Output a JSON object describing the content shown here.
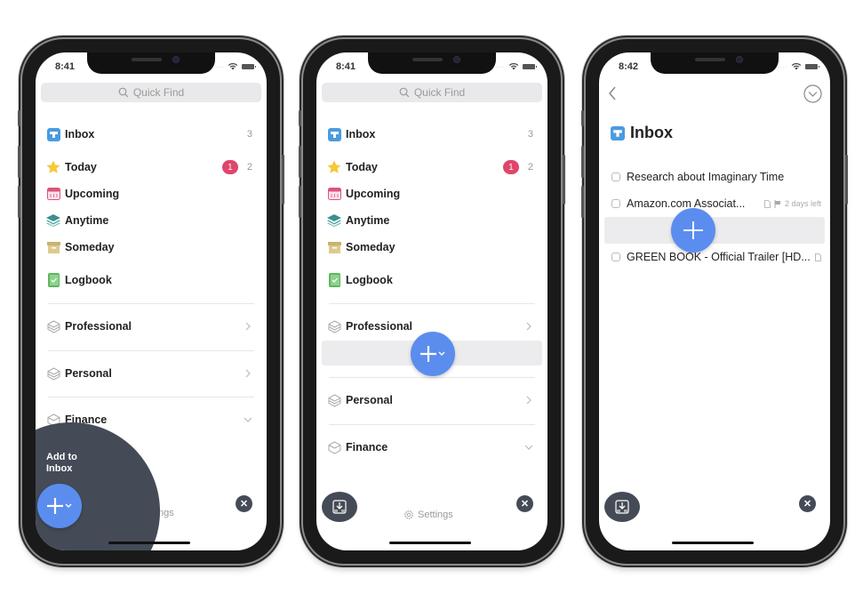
{
  "colors": {
    "accent": "#5b8def",
    "badge": "#e0456a",
    "overlay": "#444b57"
  },
  "phones": [
    {
      "time": "8:41",
      "search_placeholder": "Quick Find",
      "items": [
        {
          "label": "Inbox",
          "count": "3",
          "icon": "inbox-icon"
        },
        {
          "label": "Today",
          "badge": "1",
          "count": "2",
          "icon": "star-icon"
        },
        {
          "label": "Upcoming",
          "icon": "calendar-icon"
        },
        {
          "label": "Anytime",
          "icon": "layers-icon"
        },
        {
          "label": "Someday",
          "icon": "archive-box-icon"
        },
        {
          "label": "Logbook",
          "icon": "logbook-icon"
        }
      ],
      "areas": [
        {
          "label": "Professional",
          "state": "collapsed"
        },
        {
          "label": "Personal",
          "state": "collapsed"
        },
        {
          "label": "Finance",
          "state": "expanded"
        }
      ],
      "overlay_label_1": "Add to",
      "overlay_label_2": "Inbox",
      "settings_label": "Settings"
    },
    {
      "time": "8:41",
      "search_placeholder": "Quick Find",
      "items": [
        {
          "label": "Inbox",
          "count": "3"
        },
        {
          "label": "Today",
          "badge": "1",
          "count": "2"
        },
        {
          "label": "Upcoming"
        },
        {
          "label": "Anytime"
        },
        {
          "label": "Someday"
        },
        {
          "label": "Logbook"
        }
      ],
      "areas": [
        {
          "label": "Professional"
        },
        {
          "label": "Personal"
        },
        {
          "label": "Finance"
        }
      ],
      "settings_label": "Settings"
    },
    {
      "time": "8:42",
      "title": "Inbox",
      "tasks": [
        {
          "title": "Research about Imaginary Time"
        },
        {
          "title": "Amazon.com Associat...",
          "has_note": true,
          "deadline": "2 days left"
        },
        {
          "title": "GREEN BOOK - Official Trailer [HD...",
          "has_note": true
        }
      ]
    }
  ]
}
